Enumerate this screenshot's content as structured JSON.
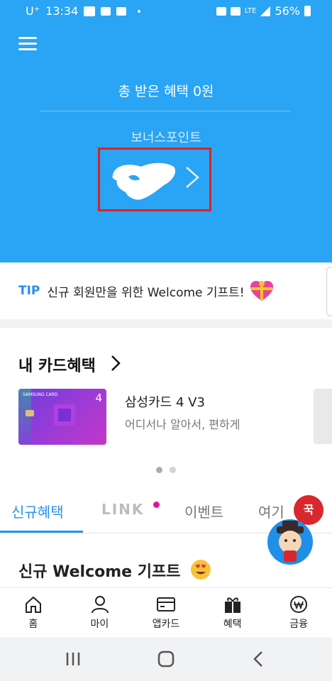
{
  "status_bar": {
    "carrier": "U⁺",
    "time": "13:34",
    "network": "LTE",
    "battery": "56%"
  },
  "hero": {
    "total_benefit": "총 받은 혜택 0원",
    "bonus_label": "보너스포인트"
  },
  "tip": {
    "label": "TIP",
    "text": "신규 회원만을 위한 Welcome 기프트!"
  },
  "my_card": {
    "title": "내 카드혜택",
    "card_brand": "SAMSUNG CARD",
    "card_number_badge": "4",
    "card_name": "삼성카드 4 V3",
    "card_desc": "어디서나 알아서, 편하게",
    "carousel_pages": 2,
    "carousel_active": 0
  },
  "tabs": {
    "items": [
      "신규혜택",
      "LINK",
      "이벤트",
      "여기"
    ],
    "active": 0,
    "stamp_text": "꾹"
  },
  "content": {
    "title": "신규 Welcome 기프트"
  },
  "bottom_nav": {
    "items": [
      "홈",
      "마이",
      "앱카드",
      "혜택",
      "금융"
    ]
  },
  "colors": {
    "primary": "#2aa4f4",
    "accent_blue": "#2a8ff0",
    "highlight_red": "#e02020",
    "link_dot": "#e0139d"
  }
}
